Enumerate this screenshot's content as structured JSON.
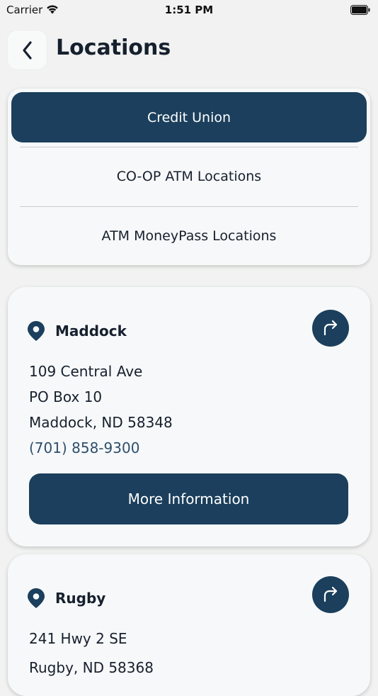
{
  "status_bar": {
    "carrier": "Carrier",
    "time": "1:51 PM"
  },
  "header": {
    "title": "Locations"
  },
  "segments": {
    "active": "Credit Union",
    "options": [
      "CO-OP ATM Locations",
      "ATM MoneyPass Locations"
    ]
  },
  "locations": [
    {
      "name": "Maddock",
      "address_lines": [
        "109 Central Ave",
        "PO Box 10",
        "Maddock, ND 58348"
      ],
      "phone": "(701) 858-9300",
      "more_label": "More Information"
    },
    {
      "name": "Rugby",
      "address_lines": [
        "241 Hwy 2 SE",
        "Rugby, ND 58368"
      ]
    }
  ],
  "icons": {
    "back": "chevron-left-icon",
    "pin": "map-pin-icon",
    "directions": "directions-arrow-icon",
    "wifi": "wifi-icon",
    "battery": "battery-icon"
  },
  "colors": {
    "accent": "#1b3f5c",
    "background": "#f1f2f1",
    "card": "#f7f8f9",
    "phone_link": "#2e4f6e"
  }
}
